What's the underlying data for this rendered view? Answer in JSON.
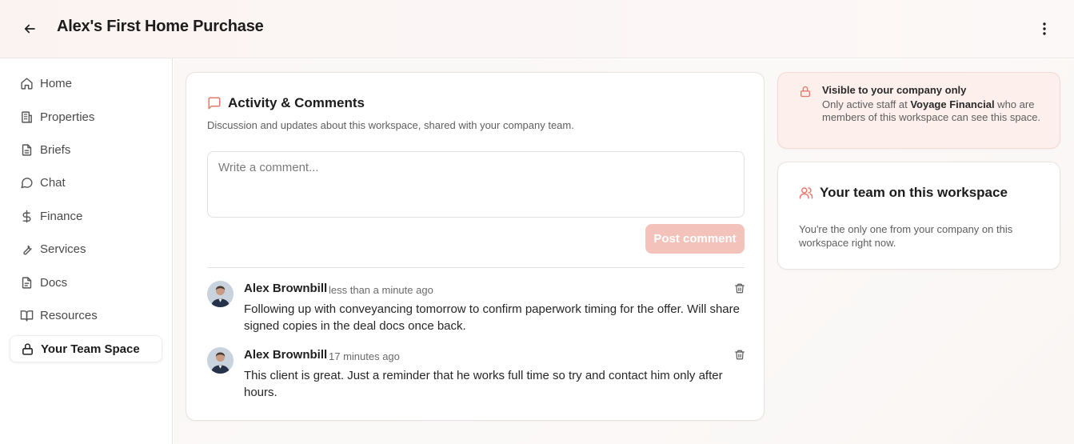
{
  "header": {
    "title": "Alex's First Home Purchase",
    "back_icon": "arrow-left-icon",
    "more_icon": "more-vertical-icon"
  },
  "sidebar": {
    "items": [
      {
        "label": "Home",
        "icon": "home-icon"
      },
      {
        "label": "Properties",
        "icon": "building-icon"
      },
      {
        "label": "Briefs",
        "icon": "file-text-icon"
      },
      {
        "label": "Chat",
        "icon": "chat-bubble-icon"
      },
      {
        "label": "Finance",
        "icon": "dollar-icon"
      },
      {
        "label": "Services",
        "icon": "wrench-icon"
      },
      {
        "label": "Docs",
        "icon": "document-icon"
      },
      {
        "label": "Resources",
        "icon": "book-open-icon"
      },
      {
        "label": "Your Team Space",
        "icon": "lock-icon",
        "active": true
      }
    ]
  },
  "activity": {
    "title": "Activity & Comments",
    "subtitle": "Discussion and updates about this workspace, shared with your company team.",
    "comment_placeholder": "Write a comment...",
    "post_label": "Post comment",
    "comments": [
      {
        "author": "Alex Brownbill",
        "time": "less than a minute ago",
        "body": "Following up with conveyancing tomorrow to confirm paperwork timing for the offer. Will share signed copies in the deal docs once back."
      },
      {
        "author": "Alex Brownbill",
        "time": "17 minutes ago",
        "body": "This client is great. Just a reminder that he works full time so try and contact him only after hours."
      }
    ]
  },
  "visibility": {
    "title": "Visible to your company only",
    "body_prefix": "Only active staff at ",
    "company": "Voyage Financial",
    "body_suffix": " who are members of this workspace can see this space."
  },
  "team": {
    "title": "Your team on this workspace",
    "body": "You're the only one from your company on this workspace right now."
  },
  "colors": {
    "accent": "#e8786a",
    "post_button": "#f2c2bb",
    "visibility_bg": "#fcefec"
  }
}
